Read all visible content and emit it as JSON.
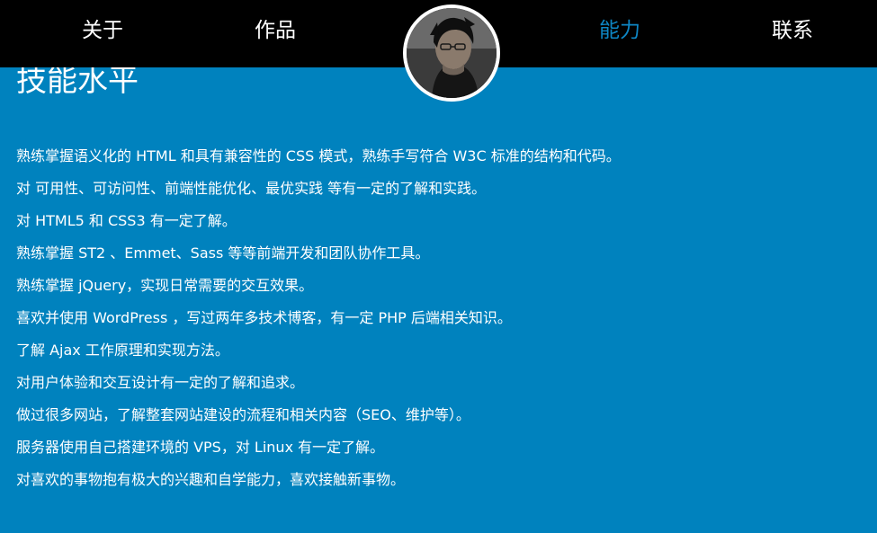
{
  "nav": {
    "items": [
      {
        "label": "关于"
      },
      {
        "label": "作品"
      },
      {
        "label": "能力"
      },
      {
        "label": "联系"
      }
    ],
    "active_color": "#0e86c4"
  },
  "colors": {
    "background": "#0082be",
    "navbar": "#000000",
    "text": "#ffffff"
  },
  "skills": {
    "title": "技能水平",
    "items": [
      "熟练掌握语义化的 HTML 和具有兼容性的 CSS 模式，熟练手写符合 W3C 标准的结构和代码。",
      "对 可用性、可访问性、前端性能优化、最优实践 等有一定的了解和实践。",
      "对 HTML5 和 CSS3 有一定了解。",
      "熟练掌握 ST2 、Emmet、Sass 等等前端开发和团队协作工具。",
      "熟练掌握 jQuery，实现日常需要的交互效果。",
      "喜欢并使用 WordPress ，写过两年多技术博客，有一定 PHP 后端相关知识。",
      "了解 Ajax 工作原理和实现方法。",
      "对用户体验和交互设计有一定的了解和追求。",
      "做过很多网站，了解整套网站建设的流程和相关内容（SEO、维护等）。",
      "服务器使用自己搭建环境的 VPS，对 Linux 有一定了解。",
      "对喜欢的事物抱有极大的兴趣和自学能力，喜欢接触新事物。"
    ]
  }
}
